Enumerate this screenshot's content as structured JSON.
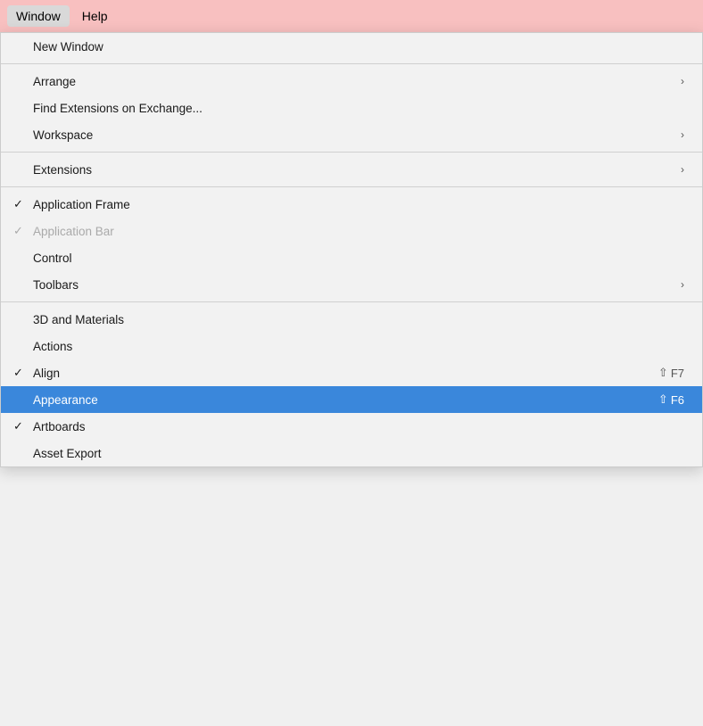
{
  "menuBar": {
    "items": [
      {
        "label": "Window",
        "active": true
      },
      {
        "label": "Help",
        "active": false
      }
    ]
  },
  "menu": {
    "items": [
      {
        "id": "new-window",
        "label": "New Window",
        "type": "item",
        "group": 1
      },
      {
        "id": "divider-1",
        "type": "divider"
      },
      {
        "id": "arrange",
        "label": "Arrange",
        "type": "item",
        "hasSubmenu": true,
        "group": 2
      },
      {
        "id": "find-extensions",
        "label": "Find Extensions on Exchange...",
        "type": "item",
        "group": 2
      },
      {
        "id": "workspace",
        "label": "Workspace",
        "type": "item",
        "hasSubmenu": true,
        "group": 2
      },
      {
        "id": "divider-2",
        "type": "divider"
      },
      {
        "id": "extensions",
        "label": "Extensions",
        "type": "item",
        "hasSubmenu": true,
        "group": 3
      },
      {
        "id": "divider-3",
        "type": "divider"
      },
      {
        "id": "application-frame",
        "label": "Application Frame",
        "type": "item",
        "checked": true,
        "group": 4
      },
      {
        "id": "application-bar",
        "label": "Application Bar",
        "type": "item",
        "checked": true,
        "disabled": true,
        "group": 4
      },
      {
        "id": "control",
        "label": "Control",
        "type": "item",
        "group": 4
      },
      {
        "id": "toolbars",
        "label": "Toolbars",
        "type": "item",
        "hasSubmenu": true,
        "group": 4
      },
      {
        "id": "divider-4",
        "type": "divider"
      },
      {
        "id": "3d-materials",
        "label": "3D and Materials",
        "type": "item",
        "group": 5
      },
      {
        "id": "actions",
        "label": "Actions",
        "type": "item",
        "group": 5
      },
      {
        "id": "align",
        "label": "Align",
        "type": "item",
        "checked": true,
        "shortcut": "⇧ F7",
        "group": 5
      },
      {
        "id": "appearance",
        "label": "Appearance",
        "type": "item",
        "highlighted": true,
        "shortcut": "⇧ F6",
        "group": 5
      },
      {
        "id": "artboards",
        "label": "Artboards",
        "type": "item",
        "checked": true,
        "group": 5
      },
      {
        "id": "asset-export",
        "label": "Asset Export",
        "type": "item",
        "group": 5
      }
    ]
  }
}
